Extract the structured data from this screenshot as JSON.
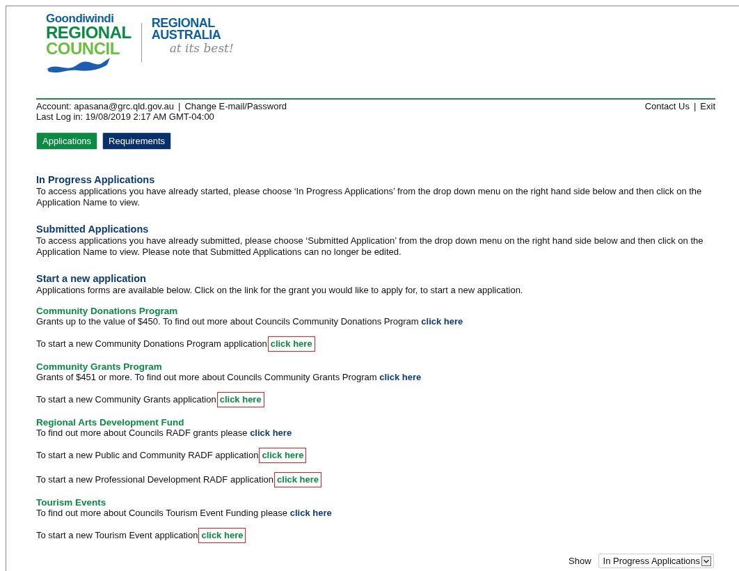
{
  "logo": {
    "council": [
      "Goondiwindi",
      "REGIONAL",
      "COUNCIL"
    ],
    "tagline": [
      "REGIONAL",
      "AUSTRALIA",
      "at its best!"
    ]
  },
  "account": {
    "label": "Account: apasana@grc.qld.gov.au",
    "separator": "|",
    "link": "Change E-mail/Password",
    "last_login": "Last Log in: 19/08/2019 2:17 AM GMT-04:00"
  },
  "top_links": {
    "items": [
      "Contact Us",
      "Exit"
    ],
    "separator": "|"
  },
  "tabs": [
    {
      "label": "Applications",
      "selected": true
    },
    {
      "label": "Requirements",
      "selected": false
    }
  ],
  "sections": [
    {
      "heading": "In Progress Applications",
      "text": "To access applications you have already started, please choose ‘In Progress Applications’ from the drop down menu on the right hand side below and then click on the Application Name to view."
    },
    {
      "heading": "Submitted Applications",
      "text": "To access applications you have already submitted, please choose ‘Submitted Application’ from the drop down menu on the right hand side below and then click on the Application Name to view. Please note that Submitted Applications can no longer be edited."
    },
    {
      "heading": "Start a new application",
      "text": "Applications forms are available below. Click on the link for the grant you would like to apply for, to start a new application."
    }
  ],
  "programs": [
    {
      "heading": "Community Donations Program",
      "info": {
        "text": "Grants up to the value of $450. To find out more about Councils Community Donations Program",
        "link": "click here"
      },
      "starts": [
        {
          "text": "To start a new Community Donations Program application",
          "link": "click here",
          "highlighted": true
        }
      ]
    },
    {
      "heading": "Community Grants Program",
      "info": {
        "text": "Grants of $451 or more. To find out more about Councils Community Grants Program",
        "link": "click here"
      },
      "starts": [
        {
          "text": "To start a new Community Grants application",
          "link": "click here",
          "highlighted": true
        }
      ]
    },
    {
      "heading": "Regional Arts Development Fund",
      "info": {
        "text": "To find out more about Councils RADF grants please",
        "link": "click here"
      },
      "starts": [
        {
          "text": "To start a new Public and Community RADF application",
          "link": "click here",
          "highlighted": true
        },
        {
          "text": "To start a new Professional Development RADF application",
          "link": "click here",
          "highlighted": true
        }
      ]
    },
    {
      "heading": "Tourism Events",
      "info": {
        "text": "To find out more about Councils Tourism Event Funding please",
        "link": "click here"
      },
      "starts": [
        {
          "text": "To start a new Tourism Event application",
          "link": "click here",
          "highlighted": true
        }
      ]
    }
  ],
  "filter": {
    "label": "Show",
    "value": "In Progress Applications"
  }
}
